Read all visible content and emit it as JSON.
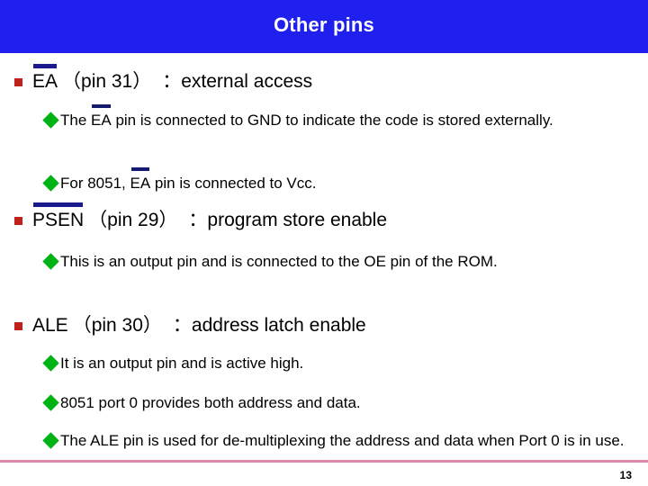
{
  "slide": {
    "title": "Other pins",
    "page_number": "13",
    "colors": {
      "banner": "#1F20ED",
      "title_text": "#FFFFFF",
      "square_bullet": "#C0211C",
      "diamond_bullet": "#00B315",
      "overline": "#161A6E",
      "rule": "#DD89AE",
      "body_text": "#000000"
    },
    "bullets": [
      {
        "id": "ea",
        "name_overlined": "EA",
        "pin": "（pin 31）",
        "colon": "：",
        "description": "external access",
        "sub": [
          {
            "id": "ea-gnd",
            "prefix": "The ",
            "overlined": "EA",
            "suffix": " pin is connected to GND to indicate the code is stored externally."
          },
          {
            "id": "ea-vcc",
            "prefix": "For 8051, ",
            "overlined": "EA",
            "suffix": " pin is connected to Vcc."
          }
        ]
      },
      {
        "id": "psen",
        "name_overlined": "PSEN",
        "pin": "（pin 29）",
        "colon": "：",
        "description": "program store enable",
        "sub": [
          {
            "id": "psen-oe",
            "prefix": "This is an output pin and is connected to the OE pin of the ROM.",
            "overlined": "",
            "suffix": ""
          }
        ]
      },
      {
        "id": "ale",
        "name_overlined": "ALE",
        "pin": "（pin 30）",
        "colon": "：",
        "description": "address latch enable",
        "sub": [
          {
            "id": "ale-active-high",
            "prefix": "It is an output pin and is active high.",
            "overlined": "",
            "suffix": ""
          },
          {
            "id": "ale-port0",
            "prefix": "8051 port 0 provides both address and data.",
            "overlined": "",
            "suffix": ""
          },
          {
            "id": "ale-demux",
            "prefix": "The ALE pin is used for de-multiplexing the address and data when Port 0 is in use.",
            "overlined": "",
            "suffix": ""
          }
        ]
      }
    ]
  }
}
